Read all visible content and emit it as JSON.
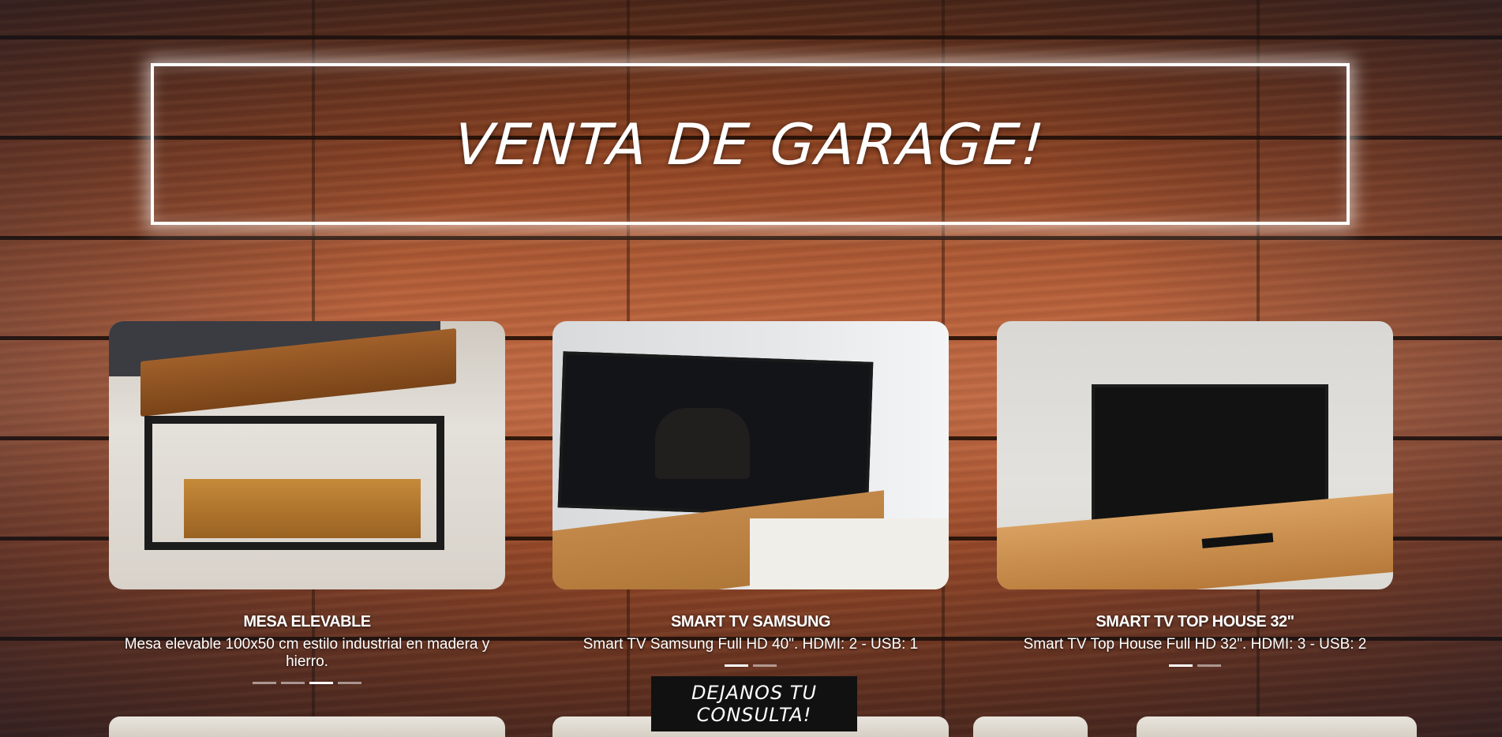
{
  "hero": {
    "title": "VENTA DE GARAGE!"
  },
  "products": [
    {
      "name": "MESA ELEVABLE",
      "description": "Mesa elevable 100x50 cm estilo industrial en madera y hierro.",
      "slides": 4,
      "active_slide": 3
    },
    {
      "name": "SMART TV SAMSUNG",
      "description": "Smart TV Samsung Full HD 40\". HDMI: 2 - USB: 1",
      "slides": 2,
      "active_slide": 1
    },
    {
      "name": "SMART TV TOP HOUSE 32\"",
      "description": "Smart TV Top House Full HD 32\". HDMI: 3 - USB: 2",
      "slides": 2,
      "active_slide": 1
    }
  ],
  "cta": {
    "label": "DEJANOS TU CONSULTA!"
  }
}
